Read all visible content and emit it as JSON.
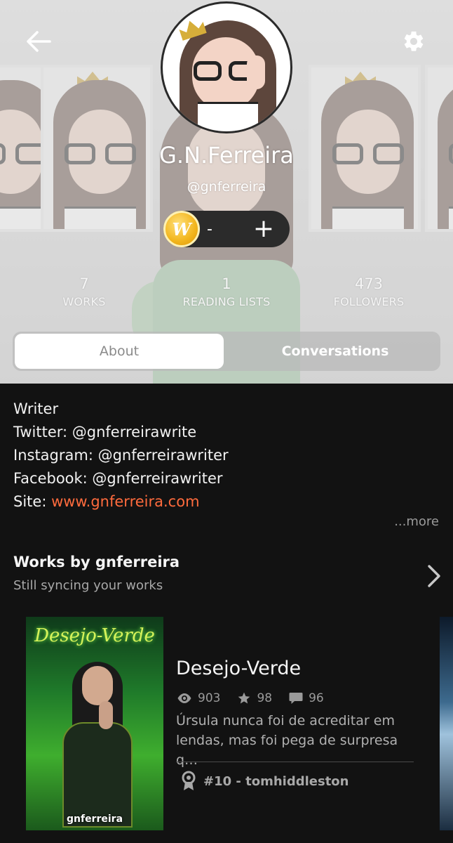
{
  "profile": {
    "display_name": "G.N.Ferreira",
    "handle": "@gnferreira",
    "coins": "-"
  },
  "stats": [
    {
      "value": "7",
      "label": "WORKS"
    },
    {
      "value": "1",
      "label": "READING LISTS"
    },
    {
      "value": "473",
      "label": "FOLLOWERS"
    }
  ],
  "tabs": {
    "about": "About",
    "conversations": "Conversations",
    "active": "About"
  },
  "bio": {
    "line1": "Writer",
    "line2": "Twitter: @gnferreirawrite",
    "line3": "Instagram: @gnferreirawriter",
    "line4": "Facebook: @gnferreirawriter",
    "site_label": "Site: ",
    "site_url": "www.gnferreira.com",
    "more": "...more"
  },
  "works": {
    "title": "Works by gnferreira",
    "subtitle": "Still syncing your works",
    "items": [
      {
        "cover_title": "Desejo-Verde",
        "cover_author": "gnferreira",
        "title": "Desejo-Verde",
        "reads": "903",
        "votes": "98",
        "comments": "96",
        "description": "Úrsula nunca foi de acreditar em lendas, mas foi pega de surpresa q…",
        "rank": "#10 - tomhiddleston"
      }
    ]
  },
  "icons": {
    "back": "arrow-left-icon",
    "settings": "gear-icon",
    "coin": "wattpad-coin-icon",
    "add": "plus-icon",
    "chevron": "chevron-right-icon",
    "reads": "eye-icon",
    "votes": "star-icon",
    "comments": "comment-icon",
    "rank": "ribbon-icon"
  },
  "colors": {
    "background": "#121212",
    "link": "#ff6b3d",
    "coin": "#f2b51c"
  }
}
